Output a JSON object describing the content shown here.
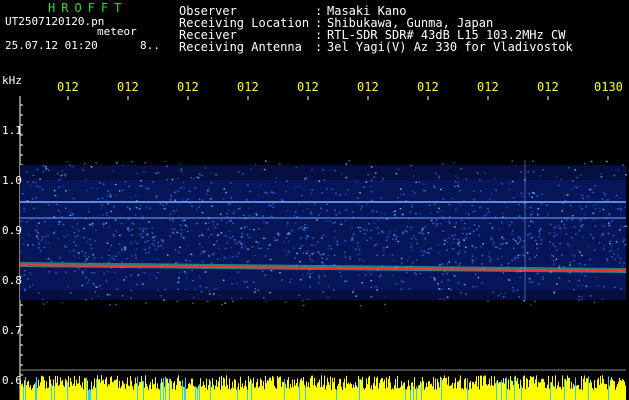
{
  "header": {
    "app_title": "HROFFT",
    "filename": "UT2507120120.pn",
    "meteor_label": "meteor",
    "datetime": "25.07.12 01:20",
    "count": "8..",
    "info": [
      {
        "label": "Observer",
        "value": "Masaki Kano"
      },
      {
        "label": "Receiving Location",
        "value": "Shibukawa, Gunma, Japan"
      },
      {
        "label": "Receiver",
        "value": "RTL-SDR SDR# 43dB L15 103.2MHz CW"
      },
      {
        "label": "Receiving Antenna",
        "value": "3el Yagi(V) Az 330 for Vladivostok"
      }
    ]
  },
  "axis": {
    "unit": "kHz",
    "y_ticks": [
      "1.1",
      "1.0",
      "0.9",
      "0.8",
      "0.7",
      "0.6"
    ],
    "x_ticks": [
      "012",
      "012",
      "012",
      "012",
      "012",
      "012",
      "012",
      "012",
      "012",
      "0130"
    ]
  },
  "colors": {
    "background": "#000000",
    "noise_low": "#0a1a6e",
    "noise_mid": "#2a66d8",
    "carrier": "#ff3030",
    "tick_text": "#ffff33",
    "title": "#22dd22",
    "amplitude_bar": "#ffff00"
  }
}
